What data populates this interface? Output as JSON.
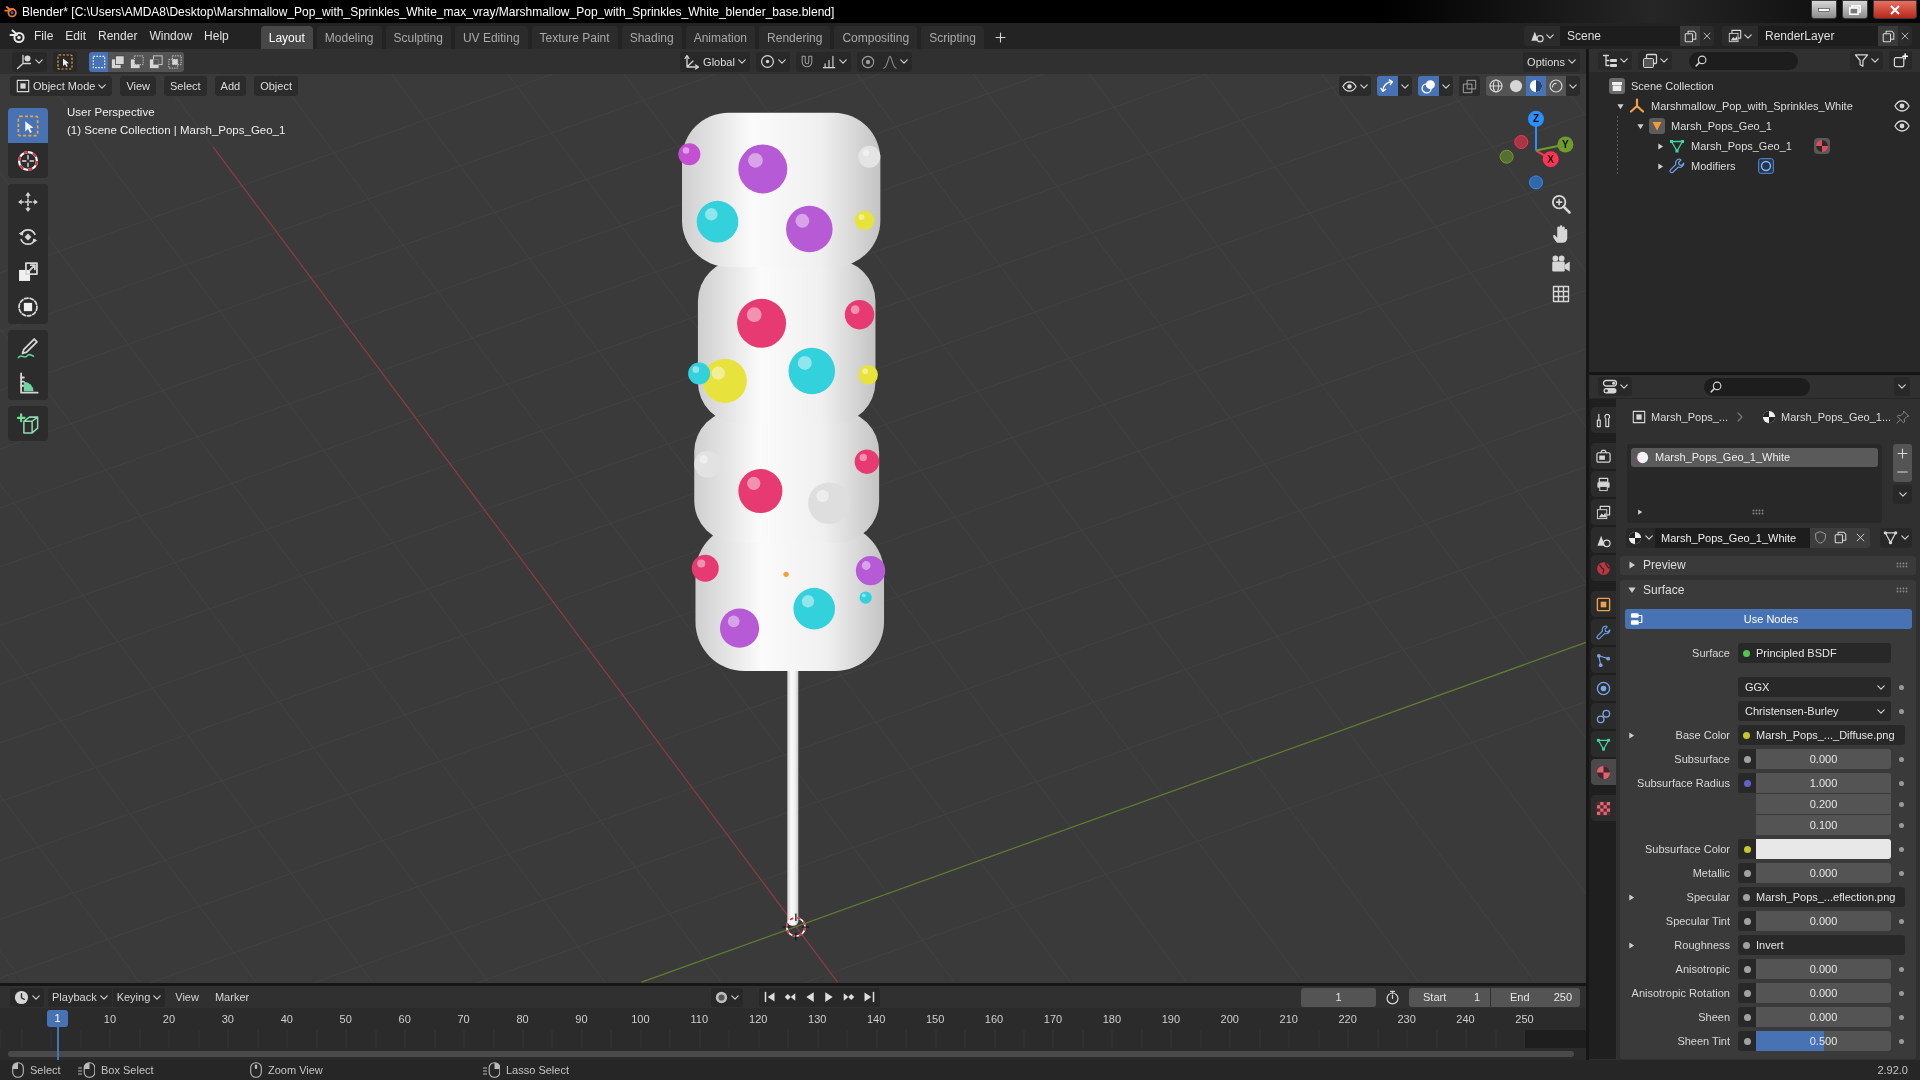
{
  "title_bar": {
    "title": "Blender* [C:\\Users\\AMDA8\\Desktop\\Marshmallow_Pop_with_Sprinkles_White_max_vray/Marshmallow_Pop_with_Sprinkles_White_blender_base.blend]"
  },
  "top_bar": {
    "menus": [
      "File",
      "Edit",
      "Render",
      "Window",
      "Help"
    ],
    "workspaces": [
      {
        "label": "Layout",
        "selected": true
      },
      {
        "label": "Modeling",
        "selected": false
      },
      {
        "label": "Sculpting",
        "selected": false
      },
      {
        "label": "UV Editing",
        "selected": false
      },
      {
        "label": "Texture Paint",
        "selected": false
      },
      {
        "label": "Shading",
        "selected": false
      },
      {
        "label": "Animation",
        "selected": false
      },
      {
        "label": "Rendering",
        "selected": false
      },
      {
        "label": "Compositing",
        "selected": false
      },
      {
        "label": "Scripting",
        "selected": false
      }
    ],
    "scene": "Scene",
    "view_layer": "RenderLayer"
  },
  "viewport": {
    "tool_header": {
      "select_modes": [
        {
          "kind": "set",
          "selected": true
        },
        {
          "kind": "extend",
          "selected": false
        },
        {
          "kind": "subtract",
          "selected": false
        },
        {
          "kind": "difference",
          "selected": false
        },
        {
          "kind": "intersect",
          "selected": false
        }
      ],
      "orientation": "Global",
      "options": "Options"
    },
    "header": {
      "mode": "Object Mode",
      "menus": [
        "View",
        "Select",
        "Add",
        "Object"
      ],
      "toggles": [
        {
          "kind": "gizmos",
          "on": true
        },
        {
          "kind": "overlays",
          "on": true
        },
        {
          "kind": "xray",
          "on": false
        }
      ],
      "shading": [
        {
          "kind": "wireframe",
          "selected": false
        },
        {
          "kind": "solid",
          "selected": false
        },
        {
          "kind": "material",
          "selected": true
        },
        {
          "kind": "rendered",
          "selected": false
        }
      ]
    },
    "tools": [
      {
        "kind": "select",
        "selected": true
      },
      {
        "kind": "cursor",
        "selected": false
      },
      {
        "kind": "move",
        "selected": false
      },
      {
        "kind": "rotate",
        "selected": false
      },
      {
        "kind": "scale",
        "selected": false
      },
      {
        "kind": "transform",
        "selected": false
      },
      {
        "kind": "annotate",
        "selected": false
      },
      {
        "kind": "measure",
        "selected": false
      },
      {
        "kind": "add_cube",
        "selected": false
      }
    ],
    "info": [
      "User Perspective",
      "(1) Scene Collection | Marsh_Pops_Geo_1"
    ],
    "gizmo": [
      {
        "label": "X",
        "color": "#ff3352"
      },
      {
        "label": "Y",
        "color": "#6f9c2b"
      },
      {
        "label": "Z",
        "color": "#2890ff"
      }
    ]
  },
  "outliner": {
    "tree": [
      {
        "label": "Scene Collection",
        "kind": "collection",
        "children": [
          {
            "label": "Marshmallow_Pop_with_Sprinkles_White",
            "kind": "empty",
            "expanded": true,
            "visible": true,
            "children": [
              {
                "label": "Marsh_Pops_Geo_1",
                "kind": "mesh_object",
                "expanded": true,
                "visible": true,
                "children": [
                  {
                    "label": "Marsh_Pops_Geo_1",
                    "kind": "mesh_data",
                    "expanded": false,
                    "badge": {
                      "kind": "material"
                    }
                  },
                  {
                    "label": "Modifiers",
                    "kind": "modifiers",
                    "expanded": false,
                    "badge": {
                      "kind": "modifier"
                    }
                  }
                ]
              }
            ]
          }
        ]
      }
    ]
  },
  "properties": {
    "tabs": [
      {
        "kind": "tool",
        "selected": false
      },
      {
        "kind": "render",
        "selected": false
      },
      {
        "kind": "output",
        "selected": false
      },
      {
        "kind": "view_layer",
        "selected": false
      },
      {
        "kind": "scene",
        "selected": false
      },
      {
        "kind": "world",
        "selected": false
      },
      {
        "kind": "object",
        "selected": false
      },
      {
        "kind": "modifiers",
        "selected": false
      },
      {
        "kind": "particles",
        "selected": false
      },
      {
        "kind": "physics",
        "selected": false
      },
      {
        "kind": "constraints",
        "selected": false
      },
      {
        "kind": "data",
        "selected": false
      },
      {
        "kind": "material",
        "selected": true
      },
      {
        "kind": "texture",
        "selected": false
      }
    ],
    "breadcrumb": [
      {
        "kind": "object",
        "label": "Marsh_Pops_..."
      },
      {
        "kind": "material",
        "label": "Marsh_Pops_Geo_1..."
      }
    ],
    "material_slots": [
      {
        "name": "Marsh_Pops_Geo_1_White",
        "selected": true
      }
    ],
    "material": "Marsh_Pops_Geo_1_White",
    "panels": [
      {
        "label": "Preview",
        "expanded": false
      },
      {
        "label": "Surface",
        "expanded": true,
        "use_nodes": "Use Nodes",
        "surface": {
          "label": "Surface",
          "value": "Principled BSDF",
          "color": "#4fc74f"
        },
        "options": [
          "GGX",
          "Christensen-Burley"
        ],
        "inputs": [
          {
            "kind": "link",
            "label": "Base Color",
            "value": "Marsh_Pops_..._Diffuse.png",
            "color": "#c7c729",
            "expanded": false
          },
          {
            "kind": "value",
            "label": "Subsurface",
            "values": [
              "0.000"
            ],
            "color": "#a1a1a1"
          },
          {
            "kind": "value",
            "label": "Subsurface Radius",
            "values": [
              "1.000",
              "0.200",
              "0.100"
            ],
            "color": "#6363c7"
          },
          {
            "kind": "swatch",
            "label": "Subsurface Color",
            "color": "#c7c729",
            "swatch": {
              "color": "#e8e8e8"
            }
          },
          {
            "kind": "value",
            "label": "Metallic",
            "values": [
              "0.000"
            ],
            "color": "#a1a1a1"
          },
          {
            "kind": "link",
            "label": "Specular",
            "value": "Marsh_Pops_...eflection.png",
            "color": "#a1a1a1",
            "expanded": false
          },
          {
            "kind": "value",
            "label": "Specular Tint",
            "values": [
              "0.000"
            ],
            "color": "#a1a1a1"
          },
          {
            "kind": "link",
            "label": "Roughness",
            "value": "Invert",
            "color": "#a1a1a1",
            "expanded": false
          },
          {
            "kind": "value",
            "label": "Anisotropic",
            "values": [
              "0.000"
            ],
            "color": "#a1a1a1"
          },
          {
            "kind": "value",
            "label": "Anisotropic Rotation",
            "values": [
              "0.000"
            ],
            "color": "#a1a1a1"
          },
          {
            "kind": "value",
            "label": "Sheen",
            "values": [
              "0.000"
            ],
            "color": "#a1a1a1"
          },
          {
            "kind": "slider",
            "label": "Sheen Tint",
            "value": "0.500",
            "level": 0.5,
            "color": "#a1a1a1"
          }
        ]
      }
    ]
  },
  "timeline": {
    "menus": [
      {
        "kind": "dropdown",
        "label": "Playback"
      },
      {
        "kind": "dropdown",
        "label": "Keying"
      },
      {
        "kind": "menu",
        "label": "View"
      },
      {
        "kind": "menu",
        "label": "Marker"
      }
    ],
    "current_frame": "1",
    "start": {
      "label": "Start",
      "value": "1"
    },
    "end": {
      "label": "End",
      "value": "250"
    },
    "playhead": "1",
    "ticks": [
      "10",
      "20",
      "30",
      "40",
      "50",
      "60",
      "70",
      "80",
      "90",
      "100",
      "110",
      "120",
      "130",
      "140",
      "150",
      "160",
      "170",
      "180",
      "190",
      "200",
      "210",
      "220",
      "230",
      "240",
      "250"
    ]
  },
  "status_bar": {
    "hints": [
      {
        "kind": "left",
        "label": "Select"
      },
      {
        "kind": "left_drag",
        "label": "Box Select"
      },
      {
        "kind": "middle",
        "label": "Zoom View"
      },
      {
        "kind": "right_drag",
        "label": "Lasso Select"
      }
    ],
    "version": "2.92.0"
  }
}
